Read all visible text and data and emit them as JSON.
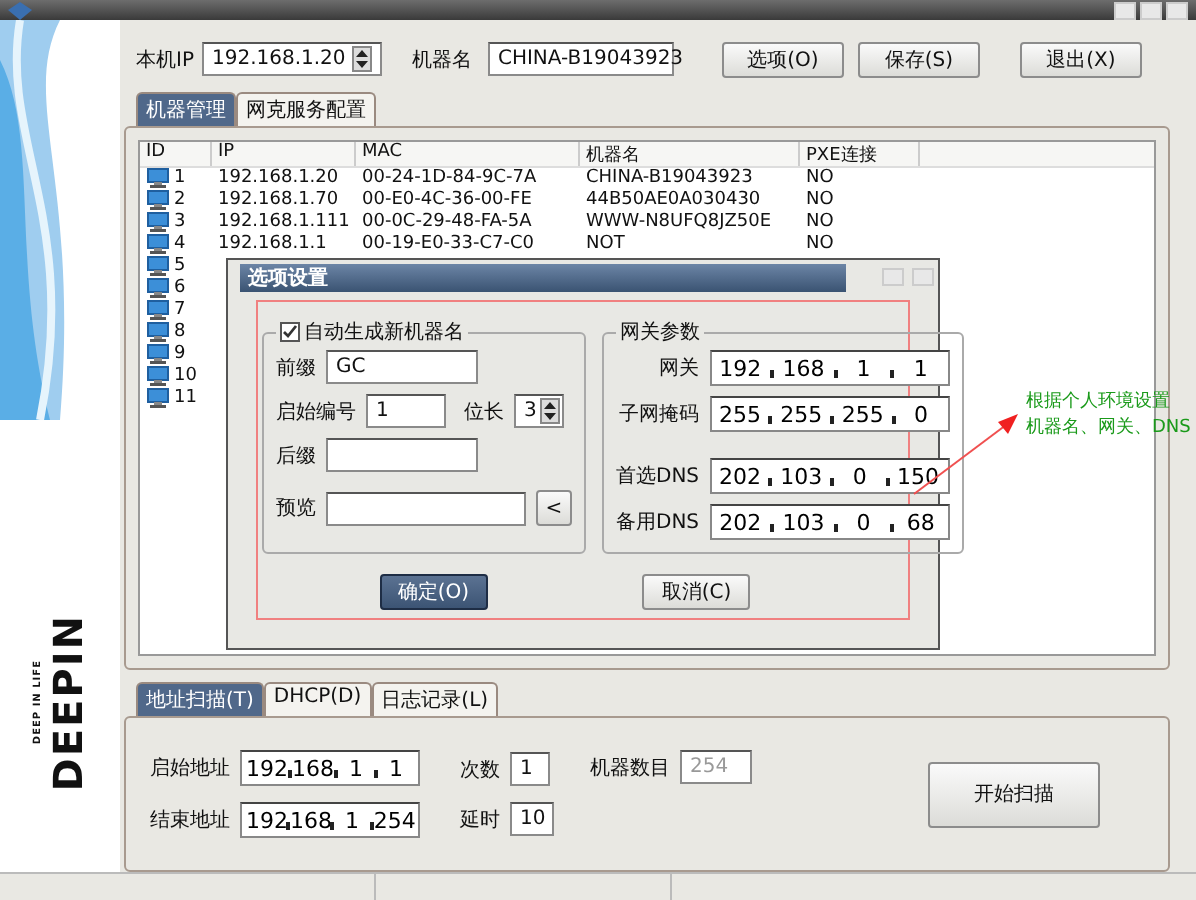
{
  "brand": {
    "name": "DEEPIN",
    "tagline": "DEEP IN LIFE"
  },
  "toolbar": {
    "ip_label": "本机IP",
    "ip_value": "192.168.1.20",
    "name_label": "机器名",
    "name_value": "CHINA-B19043923",
    "buttons": [
      "选项(O)",
      "保存(S)",
      "退出(X)"
    ]
  },
  "top_tabs": [
    {
      "label": "机器管理",
      "selected": true
    },
    {
      "label": "网克服务配置",
      "selected": false
    }
  ],
  "table": {
    "columns": [
      "ID",
      "IP",
      "MAC",
      "机器名",
      "PXE连接"
    ],
    "rows": [
      {
        "id": "1",
        "ip": "192.168.1.20",
        "mac": "00-24-1D-84-9C-7A",
        "name": "CHINA-B19043923",
        "pxe": "NO"
      },
      {
        "id": "2",
        "ip": "192.168.1.70",
        "mac": "00-E0-4C-36-00-FE",
        "name": "44B50AE0A030430",
        "pxe": "NO"
      },
      {
        "id": "3",
        "ip": "192.168.1.111",
        "mac": "00-0C-29-48-FA-5A",
        "name": "WWW-N8UFQ8JZ50E",
        "pxe": "NO"
      },
      {
        "id": "4",
        "ip": "192.168.1.1",
        "mac": "00-19-E0-33-C7-C0",
        "name": "NOT",
        "pxe": "NO"
      },
      {
        "id": "5"
      },
      {
        "id": "6"
      },
      {
        "id": "7"
      },
      {
        "id": "8"
      },
      {
        "id": "9"
      },
      {
        "id": "10"
      },
      {
        "id": "11"
      }
    ]
  },
  "dialog": {
    "title": "选项设置",
    "name_group": {
      "checkbox_label": "自动生成新机器名",
      "checked": true,
      "prefix_label": "前缀",
      "prefix": "GC",
      "start_label": "启始编号",
      "start": "1",
      "length_label": "位长",
      "length": "3",
      "suffix_label": "后缀",
      "preview_label": "预览",
      "preview_button": "<"
    },
    "gateway_group": {
      "title": "网关参数",
      "fields": [
        {
          "label": "网关",
          "ip": [
            "192",
            "168",
            "1",
            "1"
          ]
        },
        {
          "label": "子网掩码",
          "ip": [
            "255",
            "255",
            "255",
            "0"
          ]
        },
        {
          "label": "首选DNS",
          "ip": [
            "202",
            "103",
            "0",
            "150"
          ]
        },
        {
          "label": "备用DNS",
          "ip": [
            "202",
            "103",
            "0",
            "68"
          ]
        }
      ]
    },
    "buttons": [
      {
        "label": "确定(O)",
        "default": true
      },
      {
        "label": "取消(C)",
        "default": false
      }
    ]
  },
  "annotation": {
    "lines": [
      "根据个人环境设置",
      "机器名、网关、DNS"
    ]
  },
  "bottom_tabs": [
    {
      "label": "地址扫描(T)",
      "selected": true
    },
    {
      "label": "DHCP(D)",
      "selected": false
    },
    {
      "label": "日志记录(L)",
      "selected": false
    }
  ],
  "scan": {
    "start_label": "启始地址",
    "start_ip": [
      "192",
      "168",
      "1",
      "1"
    ],
    "end_label": "结束地址",
    "end_ip": [
      "192",
      "168",
      "1",
      "254"
    ],
    "count_label": "次数",
    "count": "1",
    "delay_label": "延时",
    "delay": "10",
    "machines_label": "机器数目",
    "machines": "254",
    "button": "开始扫描"
  }
}
